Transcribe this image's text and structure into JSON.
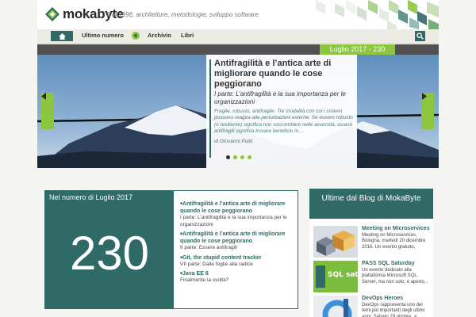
{
  "header": {
    "logo_text": "mokabyte",
    "tagline": "Dal 1996, architetture, metodologie, sviluppo software",
    "colors": {
      "brand": "#2f6a66",
      "accent": "#8cc63f"
    }
  },
  "nav": {
    "home_icon": "home-icon",
    "items": [
      "Ultimo numero",
      "Archivio",
      "Libri"
    ],
    "search_icon": "search-icon"
  },
  "issue_bar": {
    "label": "Luglio 2017 - 230"
  },
  "hero": {
    "title": "Antifragilità e l’antica arte di migliorare quando le cose peggiorano",
    "subtitle": "I parte: L’antifragilità e la sua importanza per le organizzazioni",
    "description": "Fragile, robusto, antifragile. Tre modalità con cui i sistemi possono reagire alle perturbazioni esterne. Se essere robusto (o resiliente) significa non soccombere nelle avversità, essere antifragili significa trovare beneficio in....",
    "author": "di Giovanni Puliti"
  },
  "issue_box": {
    "heading": "Nel numero di Luglio 2017",
    "number": "230",
    "articles": [
      {
        "title": "Antifragilità e l’antica arte di migliorare quando le cose peggiorano",
        "subtitle": "I parte: L’antifragilità e la sua importanza per le organizzazioni"
      },
      {
        "title": "Antifragilità e l’antica arte di migliorare quando le cose peggiorano",
        "subtitle": "II parte: Essere antifragili"
      },
      {
        "title": "Git, the stupid content tracker",
        "subtitle": "VII parte: Dalle foglie alla radice"
      },
      {
        "title": "Java EE 8",
        "subtitle": "Finalmente la svolta?"
      }
    ]
  },
  "blog": {
    "heading": "Ultime dal Blog di MokaByte",
    "items": [
      {
        "title": "Meeting on Microservices",
        "desc": "Meeting on Microservices, Bologna, martedì 20 dicembre 2016. Un evento gratuito,"
      },
      {
        "title": "PASS SQL Saturday",
        "desc": "Un evento dedicato alla piattaforma Microsoft SQL Server, ma non solo, e aperto..."
      },
      {
        "title": "DevOps Heroes",
        "desc": "DevOps rappresenta uno dei temi più importanti degli ultimi anni. Sabato 29 ottobre, a"
      }
    ],
    "thumb_label": "SQL saturday"
  }
}
